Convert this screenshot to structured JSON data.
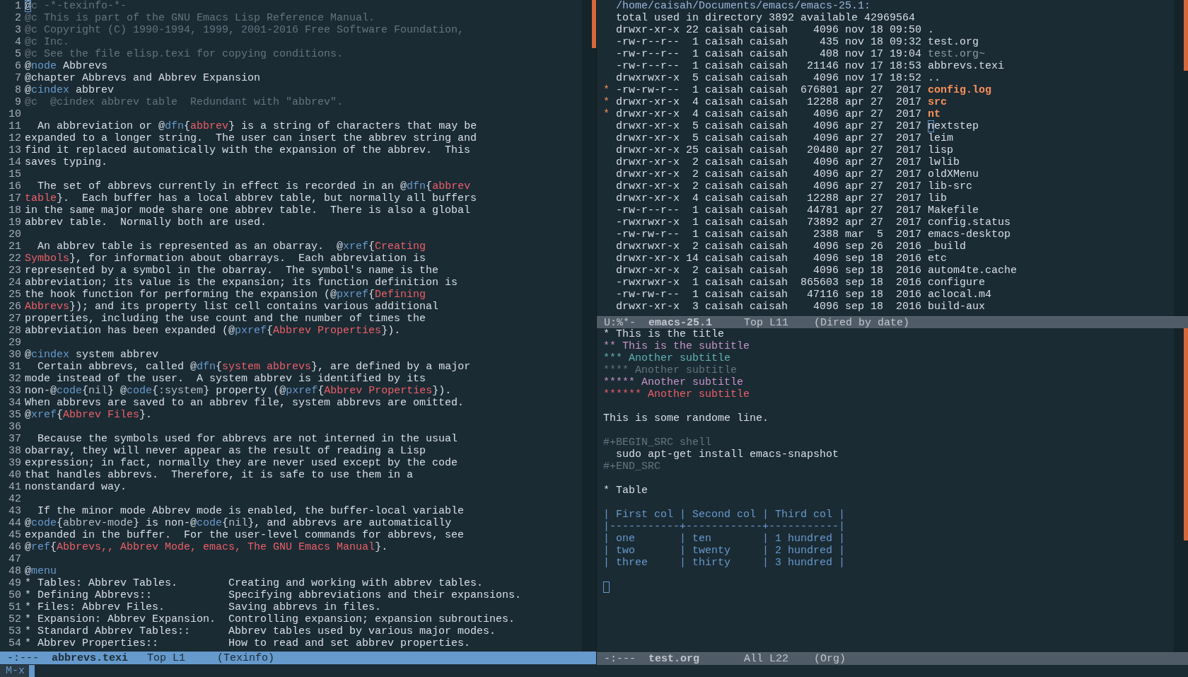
{
  "left_window": {
    "lines": [
      {
        "number": "1",
        "segments": [
          {
            "kind": "cursor",
            "text": "@"
          },
          {
            "kind": "comment",
            "text": "c -*-texinfo-*-"
          }
        ]
      },
      {
        "number": "2",
        "segments": [
          {
            "kind": "comment",
            "text": "@c This is part of the GNU Emacs Lisp Reference Manual."
          }
        ]
      },
      {
        "number": "3",
        "segments": [
          {
            "kind": "comment",
            "text": "@c Copyright (C) 1990-1994, 1999, 2001-2016 Free Software Foundation,"
          }
        ]
      },
      {
        "number": "4",
        "segments": [
          {
            "kind": "comment",
            "text": "@c Inc."
          }
        ]
      },
      {
        "number": "5",
        "segments": [
          {
            "kind": "comment",
            "text": "@c See the file elisp.texi for copying conditions."
          }
        ]
      },
      {
        "number": "6",
        "segments": [
          {
            "kind": "text",
            "text": "@"
          },
          {
            "kind": "keyword",
            "text": "node"
          },
          {
            "kind": "text",
            "text": " Abbrevs"
          }
        ]
      },
      {
        "number": "7",
        "segments": [
          {
            "kind": "text",
            "text": "@chapter Abbrevs and Abbrev Expansion"
          }
        ]
      },
      {
        "number": "8",
        "segments": [
          {
            "kind": "text",
            "text": "@"
          },
          {
            "kind": "keyword",
            "text": "cindex"
          },
          {
            "kind": "text",
            "text": " abbrev"
          }
        ]
      },
      {
        "number": "9",
        "segments": [
          {
            "kind": "comment",
            "text": "@c  @cindex abbrev table  Redundant with \"abbrev\"."
          }
        ]
      },
      {
        "number": "10"
      },
      {
        "number": "11",
        "segments": [
          {
            "kind": "text",
            "text": "  An abbreviation or @"
          },
          {
            "kind": "keyword",
            "text": "dfn"
          },
          {
            "kind": "text",
            "text": "{"
          },
          {
            "kind": "arg",
            "text": "abbrev"
          },
          {
            "kind": "text",
            "text": "} is a string of characters that may be"
          }
        ]
      },
      {
        "number": "12",
        "segments": [
          {
            "kind": "text",
            "text": "expanded to a longer string.  The user can insert the abbrev string and"
          }
        ]
      },
      {
        "number": "13",
        "segments": [
          {
            "kind": "text",
            "text": "find it replaced automatically with the expansion of the abbrev.  This"
          }
        ]
      },
      {
        "number": "14",
        "segments": [
          {
            "kind": "text",
            "text": "saves typing."
          }
        ]
      },
      {
        "number": "15"
      },
      {
        "number": "16",
        "segments": [
          {
            "kind": "text",
            "text": "  The set of abbrevs currently in effect is recorded in an @"
          },
          {
            "kind": "keyword",
            "text": "dfn"
          },
          {
            "kind": "text",
            "text": "{"
          },
          {
            "kind": "arg",
            "text": "abbrev"
          }
        ]
      },
      {
        "number": "17",
        "segments": [
          {
            "kind": "arg",
            "text": "table"
          },
          {
            "kind": "text",
            "text": "}.  Each buffer has a local abbrev table, but normally all buffers"
          }
        ]
      },
      {
        "number": "18",
        "segments": [
          {
            "kind": "text",
            "text": "in the same major mode share one abbrev table.  There is also a global"
          }
        ]
      },
      {
        "number": "19",
        "segments": [
          {
            "kind": "text",
            "text": "abbrev table.  Normally both are used."
          }
        ]
      },
      {
        "number": "20"
      },
      {
        "number": "21",
        "segments": [
          {
            "kind": "text",
            "text": "  An abbrev table is represented as an obarray.  @"
          },
          {
            "kind": "keyword",
            "text": "xref"
          },
          {
            "kind": "text",
            "text": "{"
          },
          {
            "kind": "arg",
            "text": "Creating"
          }
        ]
      },
      {
        "number": "22",
        "segments": [
          {
            "kind": "arg",
            "text": "Symbols"
          },
          {
            "kind": "text",
            "text": "}, for information about obarrays.  Each abbreviation is"
          }
        ]
      },
      {
        "number": "23",
        "segments": [
          {
            "kind": "text",
            "text": "represented by a symbol in the obarray.  The symbol's name is the"
          }
        ]
      },
      {
        "number": "24",
        "segments": [
          {
            "kind": "text",
            "text": "abbreviation; its value is the expansion; its function definition is"
          }
        ]
      },
      {
        "number": "25",
        "segments": [
          {
            "kind": "text",
            "text": "the hook function for performing the expansion (@"
          },
          {
            "kind": "keyword",
            "text": "pxref"
          },
          {
            "kind": "text",
            "text": "{"
          },
          {
            "kind": "arg",
            "text": "Defining"
          }
        ]
      },
      {
        "number": "26",
        "segments": [
          {
            "kind": "arg",
            "text": "Abbrevs"
          },
          {
            "kind": "text",
            "text": "}); and its property list cell contains various additional"
          }
        ]
      },
      {
        "number": "27",
        "segments": [
          {
            "kind": "text",
            "text": "properties, including the use count and the number of times the"
          }
        ]
      },
      {
        "number": "28",
        "segments": [
          {
            "kind": "text",
            "text": "abbreviation has been expanded (@"
          },
          {
            "kind": "keyword",
            "text": "pxref"
          },
          {
            "kind": "text",
            "text": "{"
          },
          {
            "kind": "arg",
            "text": "Abbrev Properties"
          },
          {
            "kind": "text",
            "text": "})."
          }
        ]
      },
      {
        "number": "29"
      },
      {
        "number": "30",
        "segments": [
          {
            "kind": "text",
            "text": "@"
          },
          {
            "kind": "keyword",
            "text": "cindex"
          },
          {
            "kind": "text",
            "text": " system abbrev"
          }
        ]
      },
      {
        "number": "31",
        "segments": [
          {
            "kind": "text",
            "text": "  Certain abbrevs, called @"
          },
          {
            "kind": "keyword",
            "text": "dfn"
          },
          {
            "kind": "text",
            "text": "{"
          },
          {
            "kind": "arg",
            "text": "system abbrevs"
          },
          {
            "kind": "text",
            "text": "}, are defined by a major"
          }
        ]
      },
      {
        "number": "32",
        "segments": [
          {
            "kind": "text",
            "text": "mode instead of the user.  A system abbrev is identified by its"
          }
        ]
      },
      {
        "number": "33",
        "segments": [
          {
            "kind": "text",
            "text": "non-@"
          },
          {
            "kind": "keyword",
            "text": "code"
          },
          {
            "kind": "text",
            "text": "{"
          },
          {
            "kind": "code",
            "text": "nil"
          },
          {
            "kind": "text",
            "text": "} @"
          },
          {
            "kind": "keyword",
            "text": "code"
          },
          {
            "kind": "text",
            "text": "{"
          },
          {
            "kind": "code",
            "text": ":system"
          },
          {
            "kind": "text",
            "text": "} property (@"
          },
          {
            "kind": "keyword",
            "text": "pxref"
          },
          {
            "kind": "text",
            "text": "{"
          },
          {
            "kind": "arg",
            "text": "Abbrev Properties"
          },
          {
            "kind": "text",
            "text": "})."
          }
        ]
      },
      {
        "number": "34",
        "segments": [
          {
            "kind": "text",
            "text": "When abbrevs are saved to an abbrev file, system abbrevs are omitted."
          }
        ]
      },
      {
        "number": "35",
        "segments": [
          {
            "kind": "text",
            "text": "@"
          },
          {
            "kind": "keyword",
            "text": "xref"
          },
          {
            "kind": "text",
            "text": "{"
          },
          {
            "kind": "arg",
            "text": "Abbrev Files"
          },
          {
            "kind": "text",
            "text": "}."
          }
        ]
      },
      {
        "number": "36"
      },
      {
        "number": "37",
        "segments": [
          {
            "kind": "text",
            "text": "  Because the symbols used for abbrevs are not interned in the usual"
          }
        ]
      },
      {
        "number": "38",
        "segments": [
          {
            "kind": "text",
            "text": "obarray, they will never appear as the result of reading a Lisp"
          }
        ]
      },
      {
        "number": "39",
        "segments": [
          {
            "kind": "text",
            "text": "expression; in fact, normally they are never used except by the code"
          }
        ]
      },
      {
        "number": "40",
        "segments": [
          {
            "kind": "text",
            "text": "that handles abbrevs.  Therefore, it is safe to use them in a"
          }
        ]
      },
      {
        "number": "41",
        "segments": [
          {
            "kind": "text",
            "text": "nonstandard way."
          }
        ]
      },
      {
        "number": "42"
      },
      {
        "number": "43",
        "segments": [
          {
            "kind": "text",
            "text": "  If the minor mode Abbrev mode is enabled, the buffer-local variable"
          }
        ]
      },
      {
        "number": "44",
        "segments": [
          {
            "kind": "text",
            "text": "@"
          },
          {
            "kind": "keyword",
            "text": "code"
          },
          {
            "kind": "text",
            "text": "{"
          },
          {
            "kind": "code",
            "text": "abbrev-mode"
          },
          {
            "kind": "text",
            "text": "} is non-@"
          },
          {
            "kind": "keyword",
            "text": "code"
          },
          {
            "kind": "text",
            "text": "{"
          },
          {
            "kind": "code",
            "text": "nil"
          },
          {
            "kind": "text",
            "text": "}, and abbrevs are automatically"
          }
        ]
      },
      {
        "number": "45",
        "segments": [
          {
            "kind": "text",
            "text": "expanded in the buffer.  For the user-level commands for abbrevs, see"
          }
        ]
      },
      {
        "number": "46",
        "segments": [
          {
            "kind": "text",
            "text": "@"
          },
          {
            "kind": "keyword",
            "text": "ref"
          },
          {
            "kind": "text",
            "text": "{"
          },
          {
            "kind": "arg",
            "text": "Abbrevs,, Abbrev Mode, emacs, The GNU Emacs Manual"
          },
          {
            "kind": "text",
            "text": "}."
          }
        ]
      },
      {
        "number": "47"
      },
      {
        "number": "48",
        "segments": [
          {
            "kind": "text",
            "text": "@"
          },
          {
            "kind": "keyword",
            "text": "menu"
          }
        ]
      },
      {
        "number": "49",
        "segments": [
          {
            "kind": "text",
            "text": "* Tables: Abbrev Tables.        Creating and working with abbrev tables."
          }
        ]
      },
      {
        "number": "50",
        "segments": [
          {
            "kind": "text",
            "text": "* Defining Abbrevs::            Specifying abbreviations and their expansions."
          }
        ]
      },
      {
        "number": "51",
        "segments": [
          {
            "kind": "text",
            "text": "* Files: Abbrev Files.          Saving abbrevs in files."
          }
        ]
      },
      {
        "number": "52",
        "segments": [
          {
            "kind": "text",
            "text": "* Expansion: Abbrev Expansion.  Controlling expansion; expansion subroutines."
          }
        ]
      },
      {
        "number": "53",
        "segments": [
          {
            "kind": "text",
            "text": "* Standard Abbrev Tables::      Abbrev tables used by various major modes."
          }
        ]
      },
      {
        "number": "54",
        "segments": [
          {
            "kind": "text",
            "text": "* Abbrev Properties::           How to read and set abbrev properties."
          }
        ]
      }
    ],
    "mode_line": {
      "state": "-:---",
      "buffer": "abbrevs.texi",
      "position": "Top L1",
      "mode": "(Texinfo)",
      "active": true
    }
  },
  "dired": {
    "header": "/home/caisah/Documents/emacs/emacs-25.1:",
    "total": "total used in directory 3892 available 42969564",
    "rows": [
      {
        "marked": false,
        "cursor": false,
        "kind": "file",
        "perms": "drwxr-xr-x",
        "links": "22",
        "owner": "caisah",
        "group": "caisah",
        "size": "4096",
        "month": "nov",
        "day": "18",
        "time": "09:50",
        "name": "."
      },
      {
        "marked": false,
        "cursor": false,
        "kind": "file",
        "perms": "-rw-r--r--",
        "links": "1",
        "owner": "caisah",
        "group": "caisah",
        "size": "435",
        "month": "nov",
        "day": "18",
        "time": "09:32",
        "name": "test.org"
      },
      {
        "marked": false,
        "cursor": false,
        "kind": "backup",
        "perms": "-rw-r--r--",
        "links": "1",
        "owner": "caisah",
        "group": "caisah",
        "size": "408",
        "month": "nov",
        "day": "17",
        "time": "19:04",
        "name": "test.org~"
      },
      {
        "marked": false,
        "cursor": false,
        "kind": "file",
        "perms": "-rw-r--r--",
        "links": "1",
        "owner": "caisah",
        "group": "caisah",
        "size": "21146",
        "month": "nov",
        "day": "17",
        "time": "18:53",
        "name": "abbrevs.texi"
      },
      {
        "marked": false,
        "cursor": false,
        "kind": "file",
        "perms": "drwxrwxr-x",
        "links": "5",
        "owner": "caisah",
        "group": "caisah",
        "size": "4096",
        "month": "nov",
        "day": "17",
        "time": "18:52",
        "name": ".."
      },
      {
        "marked": true,
        "mark": "*",
        "cursor": false,
        "kind": "file",
        "perms": "-rw-rw-r--",
        "links": "1",
        "owner": "caisah",
        "group": "caisah",
        "size": "676801",
        "month": "apr",
        "day": "27",
        "time": "2017",
        "name": "config.log"
      },
      {
        "marked": true,
        "mark": "*",
        "cursor": false,
        "kind": "file",
        "perms": "drwxr-xr-x",
        "links": "4",
        "owner": "caisah",
        "group": "caisah",
        "size": "12288",
        "month": "apr",
        "day": "27",
        "time": "2017",
        "name": "src"
      },
      {
        "marked": true,
        "mark": "*",
        "cursor": false,
        "kind": "file",
        "perms": "drwxr-xr-x",
        "links": "4",
        "owner": "caisah",
        "group": "caisah",
        "size": "4096",
        "month": "apr",
        "day": "27",
        "time": "2017",
        "name": "nt"
      },
      {
        "marked": false,
        "cursor": true,
        "kind": "file",
        "perms": "drwxr-xr-x",
        "links": "5",
        "owner": "caisah",
        "group": "caisah",
        "size": "4096",
        "month": "apr",
        "day": "27",
        "time": "2017",
        "name": "nextstep"
      },
      {
        "marked": false,
        "cursor": false,
        "kind": "file",
        "perms": "drwxr-xr-x",
        "links": "5",
        "owner": "caisah",
        "group": "caisah",
        "size": "4096",
        "month": "apr",
        "day": "27",
        "time": "2017",
        "name": "leim"
      },
      {
        "marked": false,
        "cursor": false,
        "kind": "file",
        "perms": "drwxr-xr-x",
        "links": "25",
        "owner": "caisah",
        "group": "caisah",
        "size": "20480",
        "month": "apr",
        "day": "27",
        "time": "2017",
        "name": "lisp"
      },
      {
        "marked": false,
        "cursor": false,
        "kind": "file",
        "perms": "drwxr-xr-x",
        "links": "2",
        "owner": "caisah",
        "group": "caisah",
        "size": "4096",
        "month": "apr",
        "day": "27",
        "time": "2017",
        "name": "lwlib"
      },
      {
        "marked": false,
        "cursor": false,
        "kind": "file",
        "perms": "drwxr-xr-x",
        "links": "2",
        "owner": "caisah",
        "group": "caisah",
        "size": "4096",
        "month": "apr",
        "day": "27",
        "time": "2017",
        "name": "oldXMenu"
      },
      {
        "marked": false,
        "cursor": false,
        "kind": "file",
        "perms": "drwxr-xr-x",
        "links": "2",
        "owner": "caisah",
        "group": "caisah",
        "size": "4096",
        "month": "apr",
        "day": "27",
        "time": "2017",
        "name": "lib-src"
      },
      {
        "marked": false,
        "cursor": false,
        "kind": "file",
        "perms": "drwxr-xr-x",
        "links": "4",
        "owner": "caisah",
        "group": "caisah",
        "size": "12288",
        "month": "apr",
        "day": "27",
        "time": "2017",
        "name": "lib"
      },
      {
        "marked": false,
        "cursor": false,
        "kind": "file",
        "perms": "-rw-r--r--",
        "links": "1",
        "owner": "caisah",
        "group": "caisah",
        "size": "44781",
        "month": "apr",
        "day": "27",
        "time": "2017",
        "name": "Makefile"
      },
      {
        "marked": false,
        "cursor": false,
        "kind": "file",
        "perms": "-rwxrwxr-x",
        "links": "1",
        "owner": "caisah",
        "group": "caisah",
        "size": "73892",
        "month": "apr",
        "day": "27",
        "time": "2017",
        "name": "config.status"
      },
      {
        "marked": false,
        "cursor": false,
        "kind": "file",
        "perms": "-rw-rw-r--",
        "links": "1",
        "owner": "caisah",
        "group": "caisah",
        "size": "2388",
        "month": "mar",
        "day": "5",
        "time": "2017",
        "name": "emacs-desktop"
      },
      {
        "marked": false,
        "cursor": false,
        "kind": "file",
        "perms": "drwxrwxr-x",
        "links": "2",
        "owner": "caisah",
        "group": "caisah",
        "size": "4096",
        "month": "sep",
        "day": "26",
        "time": "2016",
        "name": "_build"
      },
      {
        "marked": false,
        "cursor": false,
        "kind": "file",
        "perms": "drwxr-xr-x",
        "links": "14",
        "owner": "caisah",
        "group": "caisah",
        "size": "4096",
        "month": "sep",
        "day": "18",
        "time": "2016",
        "name": "etc"
      },
      {
        "marked": false,
        "cursor": false,
        "kind": "file",
        "perms": "drwxr-xr-x",
        "links": "2",
        "owner": "caisah",
        "group": "caisah",
        "size": "4096",
        "month": "sep",
        "day": "18",
        "time": "2016",
        "name": "autom4te.cache"
      },
      {
        "marked": false,
        "cursor": false,
        "kind": "file",
        "perms": "-rwxrwxr-x",
        "links": "1",
        "owner": "caisah",
        "group": "caisah",
        "size": "865603",
        "month": "sep",
        "day": "18",
        "time": "2016",
        "name": "configure"
      },
      {
        "marked": false,
        "cursor": false,
        "kind": "file",
        "perms": "-rw-rw-r--",
        "links": "1",
        "owner": "caisah",
        "group": "caisah",
        "size": "47116",
        "month": "sep",
        "day": "18",
        "time": "2016",
        "name": "aclocal.m4"
      },
      {
        "marked": false,
        "cursor": false,
        "kind": "file",
        "perms": "drwxr-xr-x",
        "links": "3",
        "owner": "caisah",
        "group": "caisah",
        "size": "4096",
        "month": "sep",
        "day": "18",
        "time": "2016",
        "name": "build-aux"
      }
    ],
    "mode_line": {
      "state": "U:%*-",
      "buffer": "emacs-25.1",
      "position": "Top L11",
      "mode": "(Dired by date)",
      "active": false
    }
  },
  "org": {
    "lines": [
      {
        "kind": "h1",
        "text": "* This is the title"
      },
      {
        "kind": "h2",
        "text": "** This is the subtitle"
      },
      {
        "kind": "h3",
        "text": "*** Another subtitle"
      },
      {
        "kind": "h4",
        "text": "**** Another subtitle"
      },
      {
        "kind": "h5",
        "text": "***** Another subtitle"
      },
      {
        "kind": "h6",
        "text": "****** Another subtitle"
      },
      {
        "kind": "blank"
      },
      {
        "kind": "text",
        "text": "This is some randome line."
      },
      {
        "kind": "blank"
      },
      {
        "kind": "meta",
        "text": "#+BEGIN_SRC shell"
      },
      {
        "kind": "code",
        "text": "  sudo apt-get install emacs-snapshot"
      },
      {
        "kind": "meta",
        "text": "#+END_SRC"
      },
      {
        "kind": "blank"
      },
      {
        "kind": "h1",
        "text": "* Table"
      },
      {
        "kind": "blank"
      },
      {
        "kind": "table",
        "text": "| First col | Second col | Third col |"
      },
      {
        "kind": "table",
        "text": "|-----------+------------+-----------|"
      },
      {
        "kind": "table",
        "text": "| one       | ten        | 1 hundred |"
      },
      {
        "kind": "table",
        "text": "| two       | twenty     | 2 hundred |"
      },
      {
        "kind": "table",
        "text": "| three     | thirty     | 3 hundred |"
      },
      {
        "kind": "blank"
      },
      {
        "kind": "cursor"
      }
    ],
    "mode_line": {
      "state": "-:---",
      "buffer": "test.org",
      "position": "All L22",
      "mode": "(Org)",
      "active": false
    }
  },
  "minibuffer": {
    "prompt": "M-x"
  }
}
